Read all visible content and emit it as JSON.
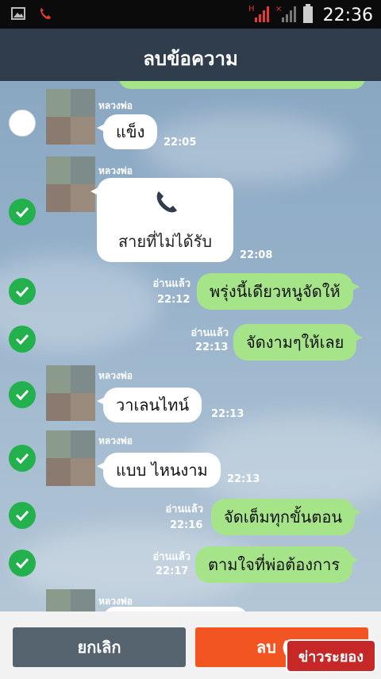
{
  "status_bar": {
    "time": "22:36",
    "icons": [
      "image-icon",
      "phone-icon",
      "signal-h-icon",
      "signal-x-icon",
      "battery-icon"
    ]
  },
  "header": {
    "title": "ลบข้อความ"
  },
  "messages": [
    {
      "side": "left",
      "sender": "หลวงพ่อ",
      "text": "แข็ง",
      "time": "22:05",
      "selected": false
    },
    {
      "side": "left",
      "sender": "หลวงพ่อ",
      "type": "missed-call",
      "text": "สายที่ไม่ได้รับ",
      "time": "22:08",
      "selected": true
    },
    {
      "side": "right",
      "read": "อ่านแล้ว",
      "text": "พรุ่งนี้เดียวหนูจัดให้",
      "time": "22:12",
      "selected": true
    },
    {
      "side": "right",
      "read": "อ่านแล้ว",
      "text": "จัดงามๆให้เลย",
      "time": "22:13",
      "selected": true
    },
    {
      "side": "left",
      "sender": "หลวงพ่อ",
      "text": "วาเลนไทน์",
      "time": "22:13",
      "selected": true
    },
    {
      "side": "left",
      "sender": "หลวงพ่อ",
      "text": "แบบ ไหนงาม",
      "time": "22:13",
      "selected": true
    },
    {
      "side": "right",
      "read": "อ่านแล้ว",
      "text": "จัดเต็มทุกขั้นตอน",
      "time": "22:16",
      "selected": true
    },
    {
      "side": "right",
      "read": "อ่านแล้ว",
      "text": "ตามใจที่พ่อต้องการ",
      "time": "22:17",
      "selected": true
    },
    {
      "side": "left",
      "sender": "หลวงพ่อ",
      "text": "",
      "time": "",
      "selected": false
    }
  ],
  "footer": {
    "cancel_label": "ยกเลิก",
    "delete_label": "ลบ (8)"
  },
  "watermark": {
    "logo_text": "ข่าวระยอง"
  },
  "colors": {
    "header": "#2f3d4c",
    "sent_bubble": "#a6e48a",
    "check": "#22b14c",
    "delete": "#f25522",
    "cancel": "#55636f"
  }
}
